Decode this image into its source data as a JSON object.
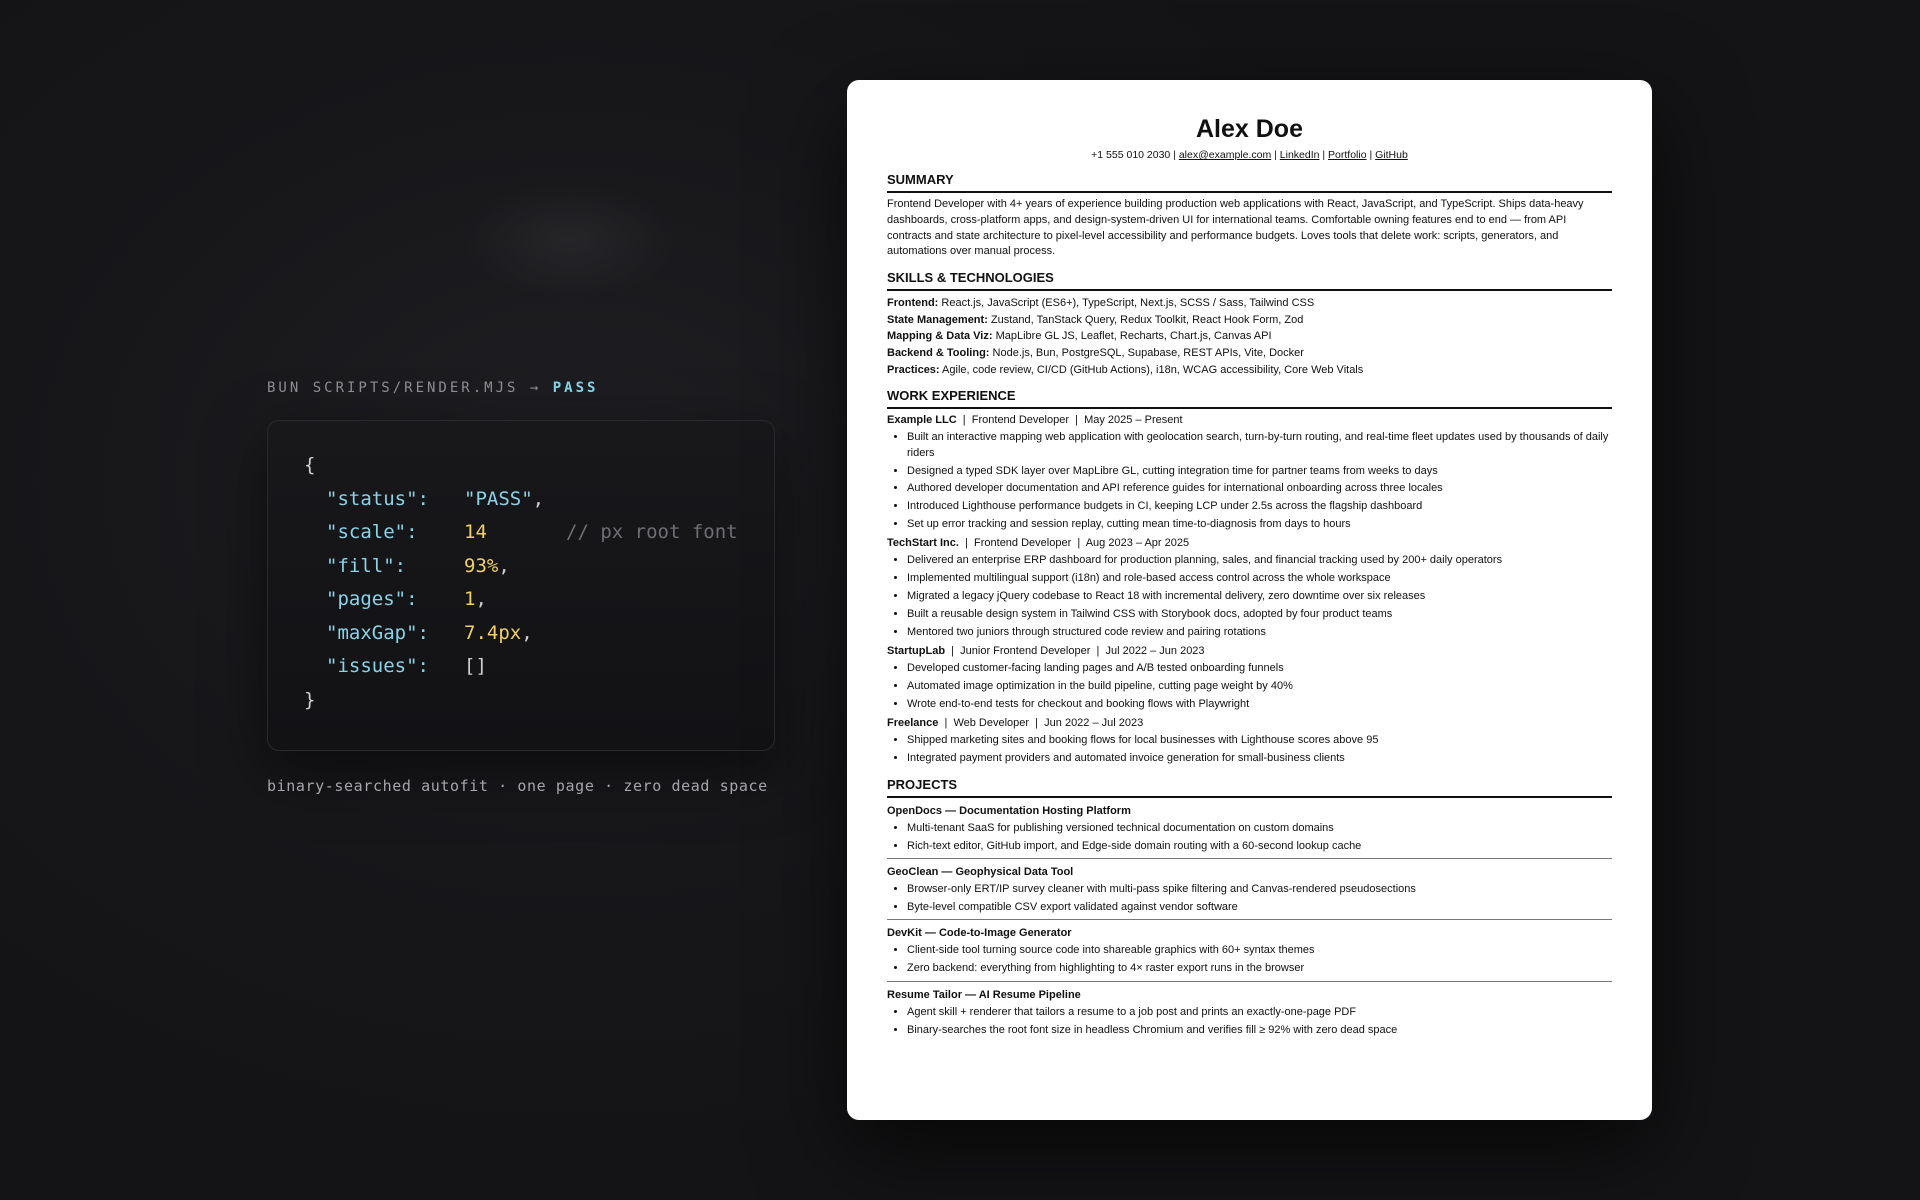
{
  "terminal": {
    "command": "BUN SCRIPTS/RENDER.MJS →",
    "result": "PASS",
    "code": {
      "open_brace": "{",
      "close_brace": "}",
      "status_key": "\"status\":",
      "status_val": "\"PASS\"",
      "scale_key": "\"scale\":",
      "scale_val": "14",
      "scale_comment": "// px root font",
      "fill_key": "\"fill\":",
      "fill_val": "93%",
      "pages_key": "\"pages\":",
      "pages_val": "1",
      "maxgap_key": "\"maxGap\":",
      "maxgap_val": "7.4px",
      "issues_key": "\"issues\":",
      "issues_val": "[]"
    },
    "caption": "binary-searched autofit · one page · zero dead space"
  },
  "resume": {
    "name": "Alex Doe",
    "phone": "+1 555 010 2030",
    "email": "alex@example.com",
    "linkedin": "LinkedIn",
    "portfolio": "Portfolio",
    "github": "GitHub",
    "summary_title": "SUMMARY",
    "summary": "Frontend Developer with 4+ years of experience building production web applications with React, JavaScript, and TypeScript. Ships data-heavy dashboards, cross-platform apps, and design-system-driven UI for international teams. Comfortable owning features end to end — from API contracts and state architecture to pixel-level accessibility and performance budgets. Loves tools that delete work: scripts, generators, and automations over manual process.",
    "skills_title": "SKILLS & TECHNOLOGIES",
    "skills": [
      {
        "label": "Frontend:",
        "value": " React.js, JavaScript (ES6+), TypeScript, Next.js, SCSS / Sass, Tailwind CSS"
      },
      {
        "label": "State Management:",
        "value": " Zustand, TanStack Query, Redux Toolkit, React Hook Form, Zod"
      },
      {
        "label": "Mapping & Data Viz:",
        "value": " MapLibre GL JS, Leaflet, Recharts, Chart.js, Canvas API"
      },
      {
        "label": "Backend & Tooling:",
        "value": " Node.js, Bun, PostgreSQL, Supabase, REST APIs, Vite, Docker"
      },
      {
        "label": "Practices:",
        "value": " Agile, code review, CI/CD (GitHub Actions), i18n, WCAG accessibility, Core Web Vitals"
      }
    ],
    "work_title": "WORK EXPERIENCE",
    "jobs": [
      {
        "company": "Example LLC",
        "details": "  |  Frontend Developer  |  May 2025 – Present",
        "bullets": [
          "Built an interactive mapping web application with geolocation search, turn-by-turn routing, and real-time fleet updates used by thousands of daily riders",
          "Designed a typed SDK layer over MapLibre GL, cutting integration time for partner teams from weeks to days",
          "Authored developer documentation and API reference guides for international onboarding across three locales",
          "Introduced Lighthouse performance budgets in CI, keeping LCP under 2.5s across the flagship dashboard",
          "Set up error tracking and session replay, cutting mean time-to-diagnosis from days to hours"
        ]
      },
      {
        "company": "TechStart Inc.",
        "details": "  |  Frontend Developer  |  Aug 2023 – Apr 2025",
        "bullets": [
          "Delivered an enterprise ERP dashboard for production planning, sales, and financial tracking used by 200+ daily operators",
          "Implemented multilingual support (i18n) and role-based access control across the whole workspace",
          "Migrated a legacy jQuery codebase to React 18 with incremental delivery, zero downtime over six releases",
          "Built a reusable design system in Tailwind CSS with Storybook docs, adopted by four product teams",
          "Mentored two juniors through structured code review and pairing rotations"
        ]
      },
      {
        "company": "StartupLab",
        "details": "  |  Junior Frontend Developer  |  Jul 2022 – Jun 2023",
        "bullets": [
          "Developed customer-facing landing pages and A/B tested onboarding funnels",
          "Automated image optimization in the build pipeline, cutting page weight by 40%",
          "Wrote end-to-end tests for checkout and booking flows with Playwright"
        ]
      },
      {
        "company": "Freelance",
        "details": "  |  Web Developer  |  Jun 2022 – Jul 2023",
        "bullets": [
          "Shipped marketing sites and booking flows for local businesses with Lighthouse scores above 95",
          "Integrated payment providers and automated invoice generation for small-business clients"
        ]
      }
    ],
    "projects_title": "PROJECTS",
    "projects": [
      {
        "title": "OpenDocs — Documentation Hosting Platform",
        "bullets": [
          "Multi-tenant SaaS for publishing versioned technical documentation on custom domains",
          "Rich-text editor, GitHub import, and Edge-side domain routing with a 60-second lookup cache"
        ]
      },
      {
        "title": "GeoClean — Geophysical Data Tool",
        "bullets": [
          "Browser-only ERT/IP survey cleaner with multi-pass spike filtering and Canvas-rendered pseudosections",
          "Byte-level compatible CSV export validated against vendor software"
        ]
      },
      {
        "title": "DevKit — Code-to-Image Generator",
        "bullets": [
          "Client-side tool turning source code into shareable graphics with 60+ syntax themes",
          "Zero backend: everything from highlighting to 4× raster export runs in the browser"
        ]
      },
      {
        "title": "Resume Tailor — AI Resume Pipeline",
        "bullets": [
          "Agent skill + renderer that tailors a resume to a job post and prints an exactly-one-page PDF",
          "Binary-searches the root font size in headless Chromium and verifies fill ≥ 92% with zero dead space"
        ]
      }
    ]
  }
}
